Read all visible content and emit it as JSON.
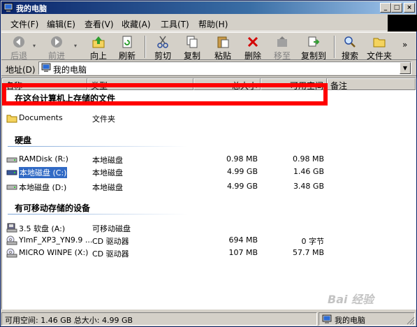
{
  "window": {
    "title": "我的电脑"
  },
  "menu": [
    "文件(F)",
    "编辑(E)",
    "查看(V)",
    "收藏(A)",
    "工具(T)",
    "帮助(H)"
  ],
  "toolbar": {
    "back": "后退",
    "forward": "前进",
    "up": "向上",
    "refresh": "刷新",
    "cut": "剪切",
    "copy": "复制",
    "paste": "粘贴",
    "delete": "删除",
    "move_to": "移至",
    "copy_to": "复制到",
    "search": "搜索",
    "folders": "文件夹",
    "overflow": "»"
  },
  "address": {
    "label": "地址(D)",
    "value": "我的电脑"
  },
  "columns": {
    "name": "名称",
    "type": "类型",
    "total": "总大小",
    "free": "可用空间",
    "notes": "备注"
  },
  "groups": {
    "stored": "在这台计算机上存储的文件",
    "hdd": "硬盘",
    "removable": "有可移动存储的设备"
  },
  "stored_items": [
    {
      "name": "Documents",
      "type": "文件夹",
      "total": "",
      "free": "",
      "icon": "folder-icon"
    }
  ],
  "hdd_items": [
    {
      "name": "RAMDisk (R:)",
      "type": "本地磁盘",
      "total": "0.98 MB",
      "free": "0.98 MB",
      "icon": "drive-icon"
    },
    {
      "name": "本地磁盘 (C:)",
      "type": "本地磁盘",
      "total": "4.99 GB",
      "free": "1.46 GB",
      "icon": "drive-icon"
    },
    {
      "name": "本地磁盘 (D:)",
      "type": "本地磁盘",
      "total": "4.99 GB",
      "free": "3.48 GB",
      "icon": "drive-icon"
    }
  ],
  "removable_items": [
    {
      "name": "3.5 软盘 (A:)",
      "type": "可移动磁盘",
      "total": "",
      "free": "",
      "icon": "floppy-icon"
    },
    {
      "name": "YlmF_XP3_YN9.9 ...",
      "type": "CD 驱动器",
      "total": "694 MB",
      "free": "0 字节",
      "icon": "cd-icon"
    },
    {
      "name": "MICRO WINPE (X:)",
      "type": "CD 驱动器",
      "total": "107 MB",
      "free": "57.7 MB",
      "icon": "cd-icon"
    }
  ],
  "status": {
    "left": "可用空间: 1.46 GB 总大小: 4.99 GB",
    "right": "我的电脑"
  },
  "watermark": "Bai 经验",
  "colors": {
    "selection": "#316ac5",
    "highlight_box": "#ff0000",
    "title_start": "#0a246a",
    "title_end": "#a6caf0"
  }
}
